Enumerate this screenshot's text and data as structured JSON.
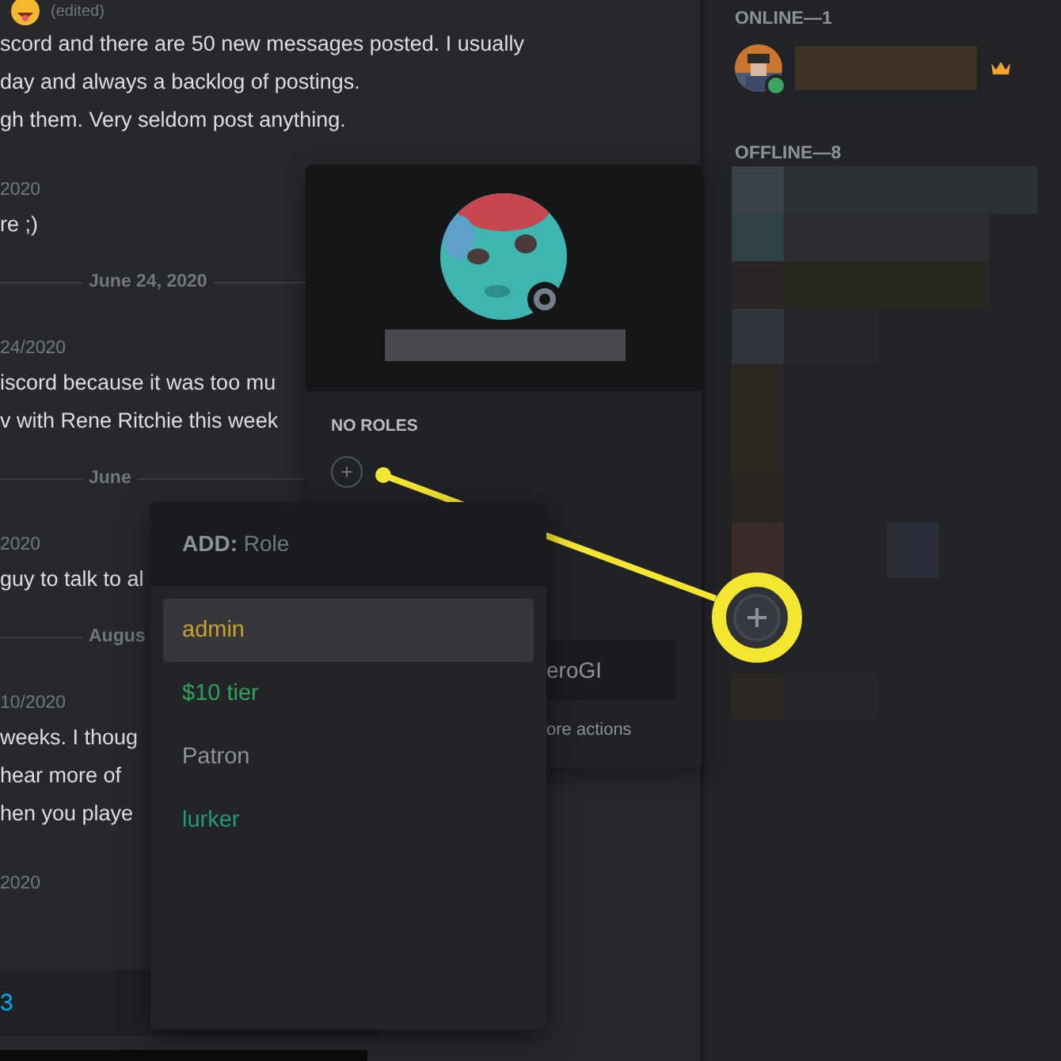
{
  "chat": {
    "lines": [
      {
        "kind": "edited",
        "text": "(edited)"
      },
      {
        "kind": "text",
        "text": "scord and there are 50 new messages posted. I usually"
      },
      {
        "kind": "text",
        "text": "day and always a backlog of postings."
      },
      {
        "kind": "text",
        "text": "gh them. Very seldom post anything."
      },
      {
        "kind": "time",
        "text": "2020"
      },
      {
        "kind": "text",
        "text": "re ;)"
      },
      {
        "kind": "divider",
        "text": "June 24, 2020"
      },
      {
        "kind": "time",
        "text": "24/2020"
      },
      {
        "kind": "text",
        "text": "iscord because it was too mu"
      },
      {
        "kind": "text",
        "text": "v with Rene Ritchie this week"
      },
      {
        "kind": "divider",
        "text": "June"
      },
      {
        "kind": "time",
        "text": "2020"
      },
      {
        "kind": "text",
        "text": "guy to talk to al"
      },
      {
        "kind": "divider",
        "text": "Augus"
      },
      {
        "kind": "time",
        "text": "10/2020"
      },
      {
        "kind": "text",
        "text": "weeks. I thoug"
      },
      {
        "kind": "text",
        "text": "hear more of"
      },
      {
        "kind": "text",
        "text": "hen you playe"
      },
      {
        "kind": "time",
        "text": "2020"
      }
    ],
    "reply_link": "3"
  },
  "profile_popout": {
    "roles_title": "NO ROLES",
    "note_value": "eroGI",
    "more_actions": "ore actions"
  },
  "role_menu": {
    "label": "ADD:",
    "placeholder": "Role",
    "roles": [
      {
        "name": "admin",
        "color": "#c9a227",
        "selected": true
      },
      {
        "name": "$10 tier",
        "color": "#2fa35a",
        "selected": false
      },
      {
        "name": "Patron",
        "color": "#8e9297",
        "selected": false
      },
      {
        "name": "lurker",
        "color": "#1f9c72",
        "selected": false
      }
    ]
  },
  "members": {
    "online_title": "ONLINE—1",
    "online_member": {
      "online": true
    },
    "offline_title": "OFFLINE—8"
  }
}
